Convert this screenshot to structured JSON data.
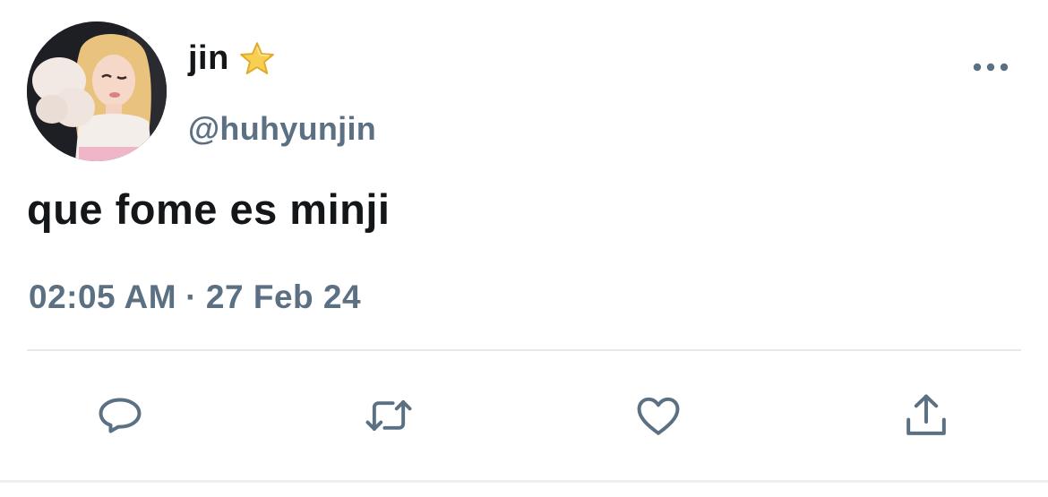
{
  "tweet": {
    "display_name": "jin",
    "name_badge_icon": "star-icon",
    "handle": "@huhyunjin",
    "text": "que fome es minji",
    "time": "02:05 AM",
    "separator": "·",
    "date": "27 Feb 24",
    "more_icon": "more-horizontal-icon"
  },
  "actions": [
    {
      "icon": "reply-icon"
    },
    {
      "icon": "retweet-icon"
    },
    {
      "icon": "like-icon"
    },
    {
      "icon": "share-icon"
    }
  ],
  "colors": {
    "text_primary": "#14171a",
    "text_secondary": "#5b7083",
    "divider": "#e6e8ea",
    "star": "#f7c842"
  }
}
